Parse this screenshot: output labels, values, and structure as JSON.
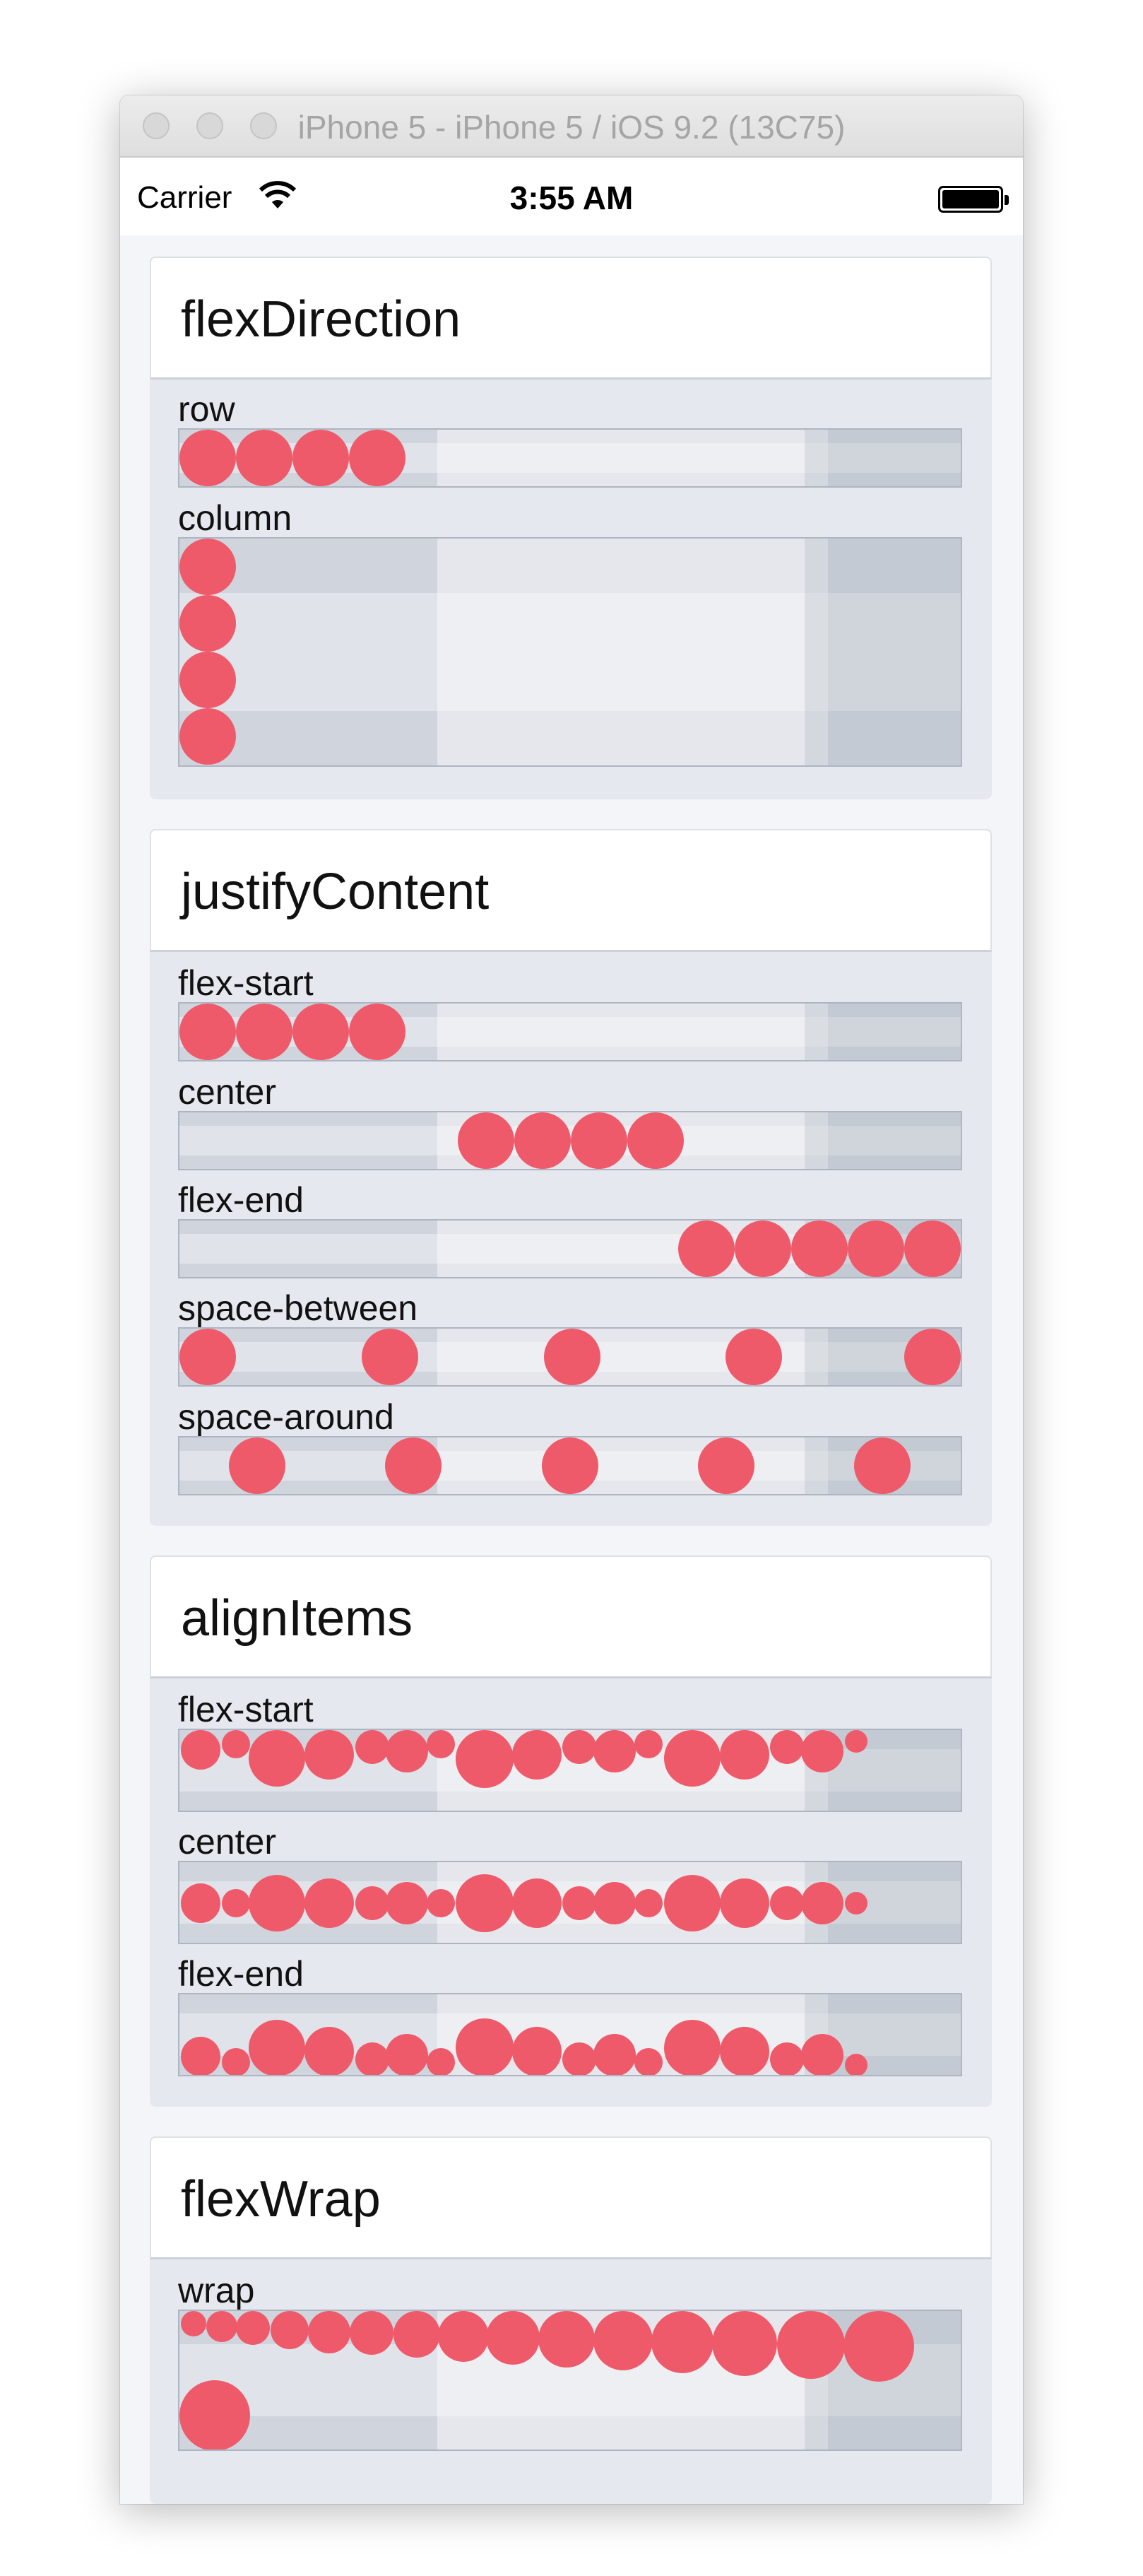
{
  "window": {
    "title": "iPhone 5 - iPhone 5 / iOS 9.2 (13C75)"
  },
  "status_bar": {
    "carrier": "Carrier",
    "time": "3:55 AM"
  },
  "colors": {
    "dot": "#ef5a6a",
    "card_bg": "#e5e8ee",
    "box_bg": "#cfd4dd"
  },
  "sections": {
    "flex_direction": {
      "title": "flexDirection",
      "row": "row",
      "column": "column"
    },
    "justify_content": {
      "title": "justifyContent",
      "flex_start": "flex-start",
      "center": "center",
      "flex_end": "flex-end",
      "space_between": "space-between",
      "space_around": "space-around"
    },
    "align_items": {
      "title": "alignItems",
      "flex_start": "flex-start",
      "center": "center",
      "flex_end": "flex-end"
    },
    "flex_wrap": {
      "title": "flexWrap",
      "wrap": "wrap"
    }
  }
}
